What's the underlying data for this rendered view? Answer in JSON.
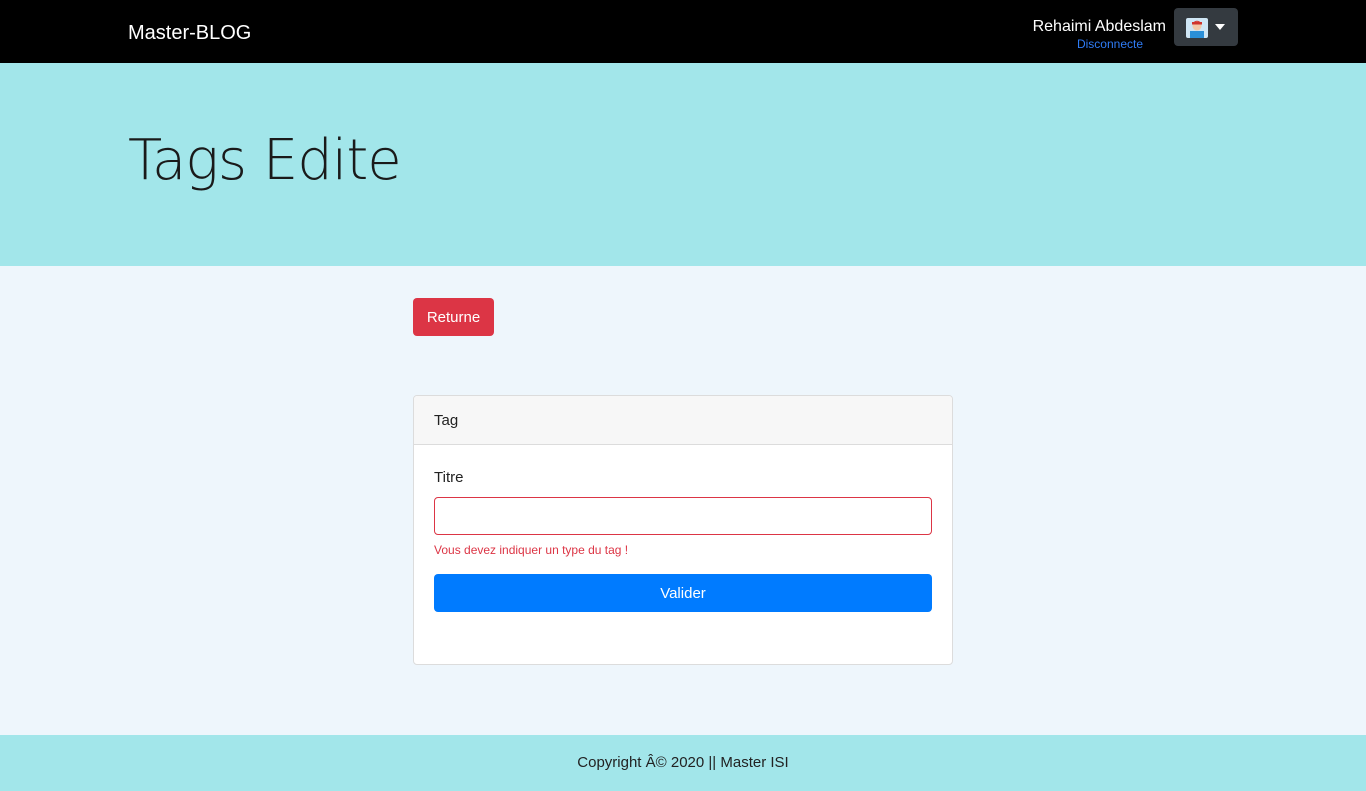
{
  "navbar": {
    "brand": "Master-BLOG",
    "user_name": "Rehaimi Abdeslam",
    "logout_label": "Disconnecte",
    "avatar_icon": "user-avatar-icon",
    "caret_icon": "caret-down-icon"
  },
  "hero": {
    "title": "Tags Edite"
  },
  "main": {
    "return_label": "Returne",
    "card": {
      "header": "Tag",
      "field_label": "Titre",
      "field_value": "",
      "field_placeholder": "",
      "error_message": "Vous devez indiquer un type du tag !",
      "submit_label": "Valider"
    }
  },
  "footer": {
    "text": "Copyright Â© 2020 || Master ISI"
  },
  "colors": {
    "navbar_bg": "#000000",
    "hero_bg": "#a2e6ea",
    "page_bg": "#eef6fc",
    "danger": "#dc3545",
    "primary": "#007bff",
    "link": "#2f7cf6"
  }
}
